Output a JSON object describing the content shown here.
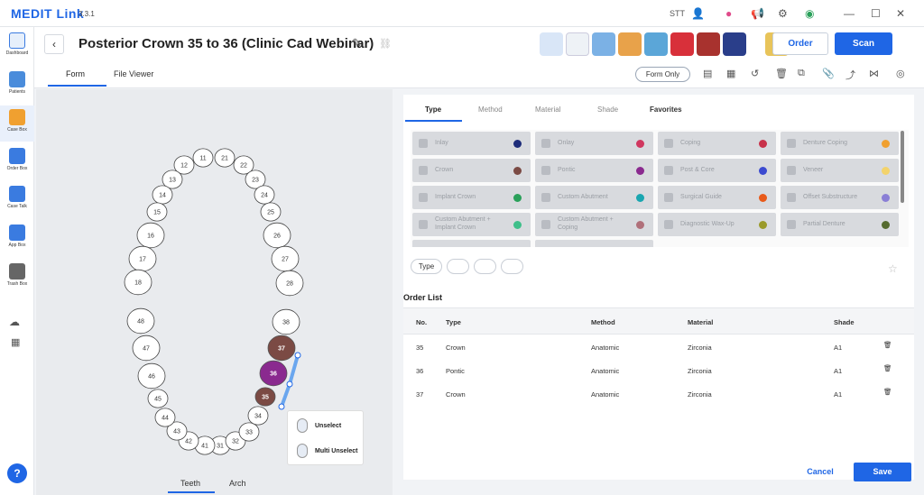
{
  "app": {
    "name": "MEDIT Link",
    "version": "3.3.1",
    "user": "STT"
  },
  "sidebar": {
    "items": [
      {
        "label": "Dashboard",
        "color": "#3a7be0"
      },
      {
        "label": "Patients",
        "color": "#4a8cdb"
      },
      {
        "label": "Case Box",
        "color": "#f0a030"
      },
      {
        "label": "Order Box",
        "color": "#3a7be0"
      },
      {
        "label": "Case Talk",
        "color": "#3a7be0"
      },
      {
        "label": "App Box",
        "color": "#3a7be0"
      },
      {
        "label": "Trash Box",
        "color": "#555"
      }
    ]
  },
  "header": {
    "title": "Posterior Crown 35 to 36 (Clinic Cad Webinar)",
    "order_label": "Order",
    "scan_label": "Scan",
    "tabs": [
      "Form",
      "File Viewer"
    ],
    "form_only": "Form Only"
  },
  "apps": [
    "app-1",
    "app-2",
    "app-3",
    "app-4",
    "app-5",
    "app-6",
    "app-7",
    "app-8",
    "app-9"
  ],
  "teeth": {
    "upper": [
      "11",
      "12",
      "13",
      "14",
      "15",
      "16",
      "17",
      "18",
      "21",
      "22",
      "23",
      "24",
      "25",
      "26",
      "27",
      "28"
    ],
    "lower": [
      "31",
      "32",
      "33",
      "34",
      "35",
      "36",
      "37",
      "38",
      "41",
      "42",
      "43",
      "44",
      "45",
      "46",
      "47",
      "48"
    ],
    "selected": [
      {
        "tooth": "35",
        "color": "#7b4a44"
      },
      {
        "tooth": "36",
        "color": "#8a2a8f"
      },
      {
        "tooth": "37",
        "color": "#7b4a44"
      }
    ],
    "view_tabs": [
      "Teeth",
      "Arch"
    ]
  },
  "tooltip": {
    "unselect": "Unselect",
    "multi_unselect": "Multi Unselect"
  },
  "type_panel": {
    "tabs": [
      "Type",
      "Method",
      "Material",
      "Shade",
      "Favorites"
    ],
    "items": [
      {
        "label": "Inlay",
        "color": "#1e2d7a"
      },
      {
        "label": "Onlay",
        "color": "#d0375f"
      },
      {
        "label": "Coping",
        "color": "#c8324a"
      },
      {
        "label": "Denture Coping",
        "color": "#f0a030"
      },
      {
        "label": "Crown",
        "color": "#7b4a44"
      },
      {
        "label": "Pontic",
        "color": "#8a2a8f"
      },
      {
        "label": "Post & Core",
        "color": "#3c4bd0"
      },
      {
        "label": "Veneer",
        "color": "#f3d36b"
      },
      {
        "label": "Implant Crown",
        "color": "#2aa05a"
      },
      {
        "label": "Custom Abutment",
        "color": "#1aa6b0"
      },
      {
        "label": "Surgical Guide",
        "color": "#e85a1a"
      },
      {
        "label": "Offset Substructure",
        "color": "#8a7fd6"
      },
      {
        "label": "Custom Abutment +",
        "label2": "Implant Crown",
        "color": "#3fbf8a"
      },
      {
        "label": "Custom Abutment +",
        "label2": "Coping",
        "color": "#b0707a"
      },
      {
        "label": "Diagnostic Wax-Up",
        "color": "#9a9a2a"
      },
      {
        "label": "Partial Denture",
        "color": "#556b2f"
      }
    ],
    "filter_pill": "Type"
  },
  "order_list": {
    "title": "Order List",
    "columns": [
      "No.",
      "Type",
      "Method",
      "Material",
      "Shade"
    ],
    "rows": [
      {
        "no": "35",
        "type": "Crown",
        "method": "Anatomic",
        "material": "Zirconia",
        "shade": "A1"
      },
      {
        "no": "36",
        "type": "Pontic",
        "method": "Anatomic",
        "material": "Zirconia",
        "shade": "A1"
      },
      {
        "no": "37",
        "type": "Crown",
        "method": "Anatomic",
        "material": "Zirconia",
        "shade": "A1"
      }
    ]
  },
  "footer": {
    "cancel": "Cancel",
    "save": "Save"
  }
}
